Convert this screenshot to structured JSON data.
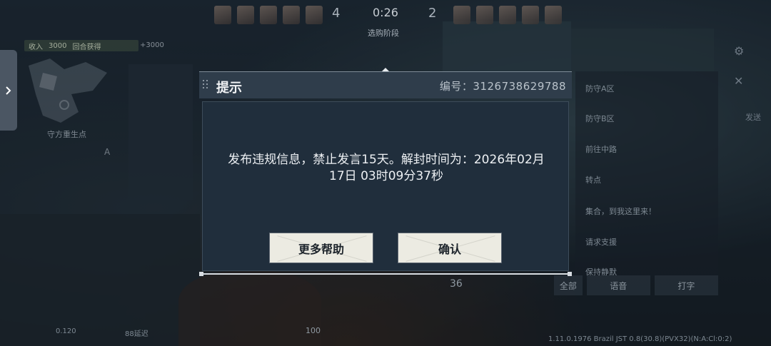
{
  "hud": {
    "money_label": "收入",
    "money_value": "3000",
    "money_extra_label": "回合获得",
    "money_extra_value": "+3000",
    "team_left_score": "4",
    "timer": "0:26",
    "team_right_score": "2",
    "phase": "选购阶段",
    "minimap_label": "守方重生点",
    "minimap_site": "A",
    "ammo": "36",
    "hp": "100",
    "bottom_left_1": "0.120",
    "bottom_left_2": "88延迟",
    "bottom_info": "1.11.0.1976 Brazil JST 0.8(30.8)(PVX32)(N:A:Cl:0:2)"
  },
  "quick_panel": {
    "items": [
      "防守A区",
      "防守B区",
      "前往中路",
      "转点",
      "集合，到我这里来！",
      "请求支援",
      "保持静默"
    ],
    "all_label": "全部",
    "voice_label": "语音",
    "type_label": "打字",
    "side_label": "发送"
  },
  "dialog": {
    "title": "提示",
    "ticket_label": "编号：3126738629788",
    "message_line1": "发布违规信息，禁止发言15天。解封时间为：2026年02月",
    "message_line2": "17日 03时09分37秒",
    "help_button": "更多帮助",
    "confirm_button": "确认"
  },
  "colors": {
    "dialog_header": "#2f3d4b",
    "dialog_body": "#202e3c",
    "button_bg": "#ecebe2",
    "button_text": "#1d242b"
  }
}
